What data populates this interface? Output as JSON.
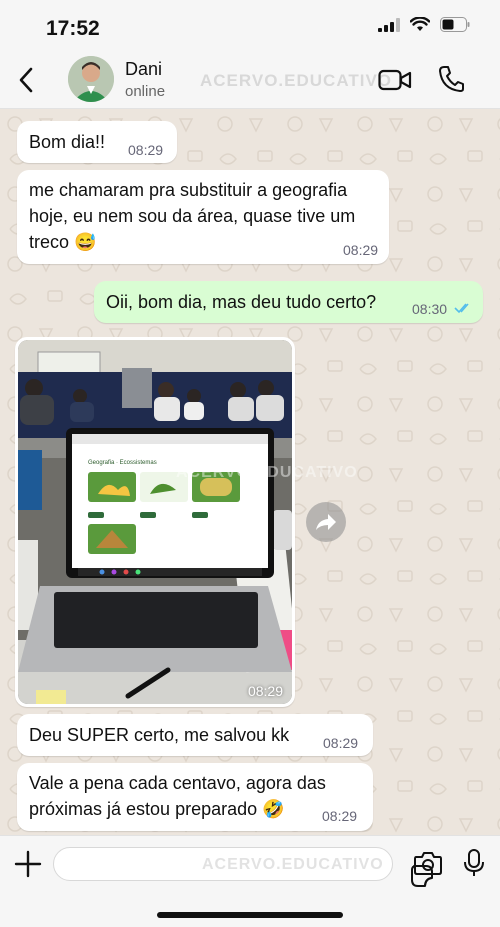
{
  "status_bar": {
    "time": "17:52"
  },
  "header": {
    "contact_name": "Dani",
    "contact_status": "online",
    "watermark": "ACERVO.EDUCATIVO"
  },
  "messages": [
    {
      "direction": "in",
      "text": "Bom dia!!",
      "time": "08:29"
    },
    {
      "direction": "in",
      "lines": [
        "me chamaram pra substituir a geografia",
        "hoje, eu nem sou da área, quase tive um",
        "treco 😅"
      ],
      "time": "08:29"
    },
    {
      "direction": "out",
      "text": "Oii, bom dia, mas deu tudo certo?",
      "time": "08:30",
      "read": true
    },
    {
      "direction": "in",
      "type": "photo",
      "time": "08:29",
      "watermark": "ACERVO.EDUCATIVO",
      "screen_title": "Geografia · Ecossistemas"
    },
    {
      "direction": "in",
      "text": "Deu SUPER certo, me salvou kk",
      "time": "08:29"
    },
    {
      "direction": "in",
      "lines": [
        "Vale a pena cada centavo, agora das",
        "próximas já estou preparado 🤣"
      ],
      "time": "08:29"
    }
  ],
  "composer": {
    "watermark": "ACERVO.EDUCATIVO"
  },
  "colors": {
    "incoming": "#ffffff",
    "outgoing": "#d9fdd3",
    "read_ticks": "#53bdeb",
    "chat_bg": "#ece5dd"
  },
  "icons": [
    "back-chevron-icon",
    "video-call-icon",
    "phone-icon",
    "forward-icon",
    "plus-icon",
    "sticker-icon",
    "camera-icon",
    "microphone-icon"
  ]
}
